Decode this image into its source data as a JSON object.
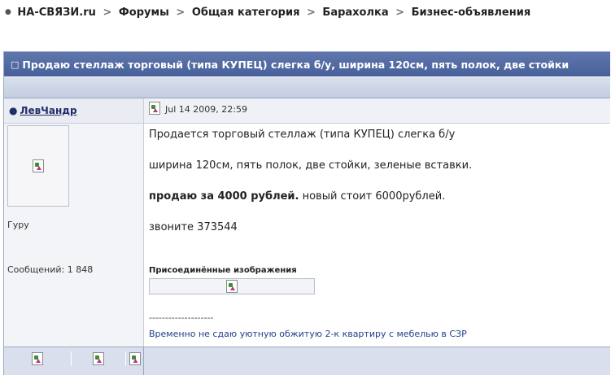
{
  "breadcrumb": {
    "items": [
      "НА-СВЯЗИ.ru",
      "Форумы",
      "Общая категория",
      "Барахолка",
      "Бизнес-объявления"
    ],
    "separator": ">"
  },
  "topic": {
    "title": "Продаю стеллаж торговый (типа КУПЕЦ) слегка б/у, ширина 120см, пять полок, две стойки"
  },
  "post": {
    "author": "ЛевЧандр",
    "date": "Jul 14 2009, 22:59",
    "rank": "Гуру",
    "posts_label": "Сообщений: 1 848",
    "body": {
      "line1": "Продается торговый стеллаж (типа КУПЕЦ) слегка б/у",
      "line2": "ширина 120см, пять полок, две стойки, зеленые вставки.",
      "line3_bold": "продаю за 4000 рублей.",
      "line3_rest": " новый стоит 6000рублей.",
      "line4": "звоните 373544"
    },
    "attachments_label": "Присоединённые изображения",
    "divider": "--------------------",
    "signature": "Временно не сдаю уютную обжитую 2-к квартиру с мебелью в СЗР"
  },
  "icons": {
    "broken_image": "broken-image-icon"
  }
}
